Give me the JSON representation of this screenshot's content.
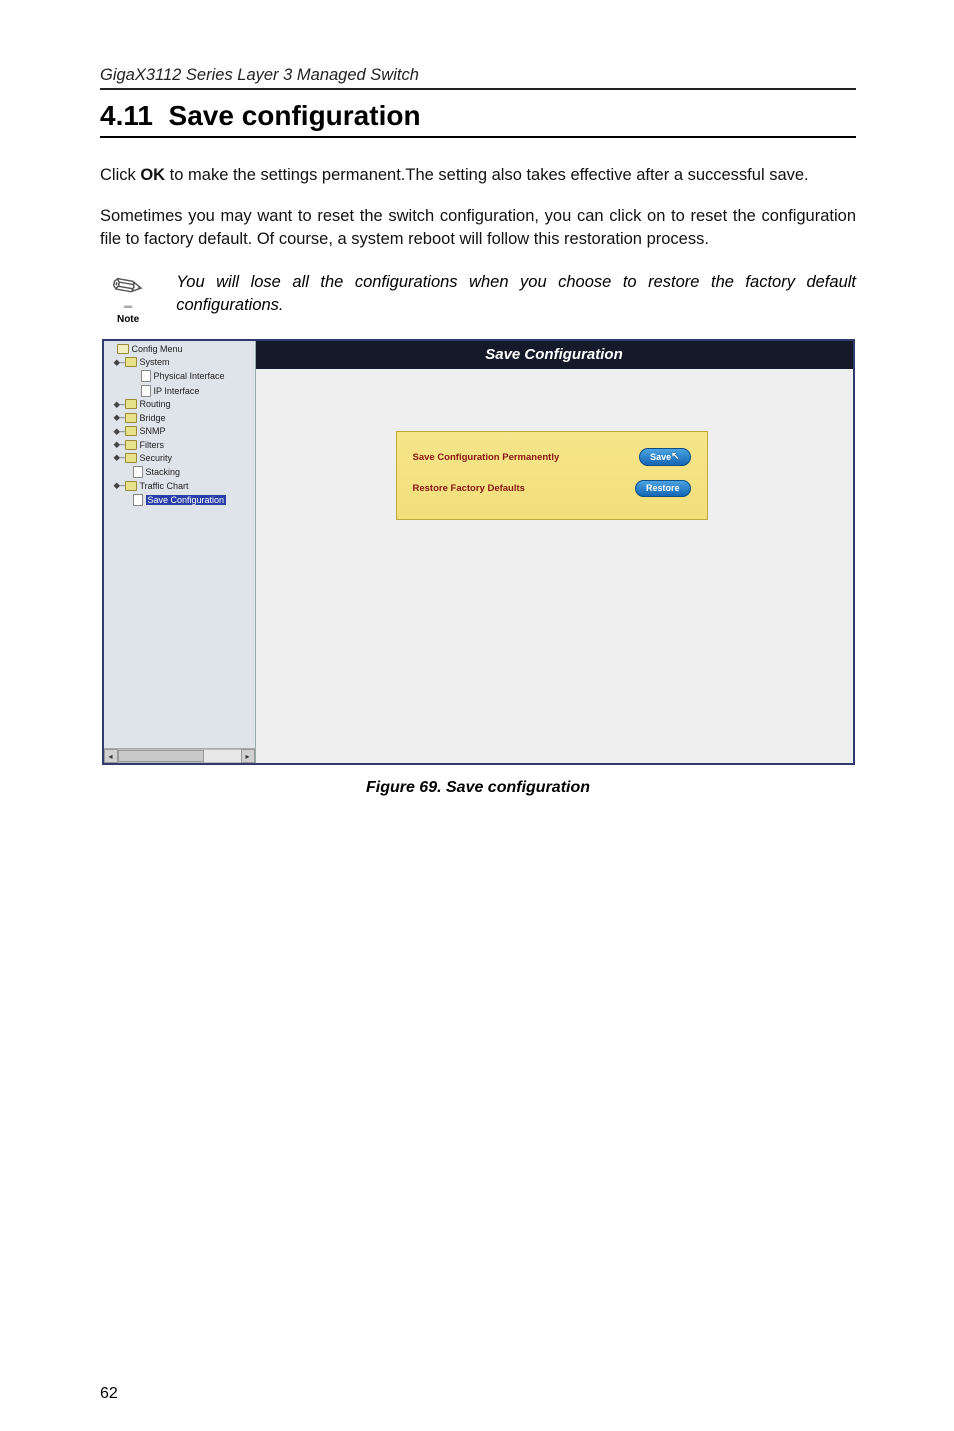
{
  "doc": {
    "header": "GigaX3112 Series Layer 3 Managed Switch",
    "section_number": "4.11",
    "section_title": "Save configuration",
    "para1_pre": "Click ",
    "para1_bold": "OK",
    "para1_post": " to make the settings permanent.The setting also takes effective after a successful save.",
    "para2": "Sometimes you may want to reset the switch configuration, you can click on   to reset the configuration file to factory default. Of course, a system reboot will follow this restoration process.",
    "note_label": "Note",
    "note_text": "You will lose all the configurations when you choose to restore the factory default configurations.",
    "figure_caption": "Figure 69. Save configuration",
    "page_number": "62"
  },
  "ui": {
    "banner": "Save Configuration",
    "sidebar": {
      "root": "Config Menu",
      "items": [
        {
          "label": "System",
          "type": "folder",
          "expanded": true,
          "children": [
            {
              "label": "Physical Interface",
              "type": "page"
            },
            {
              "label": "IP Interface",
              "type": "page"
            }
          ]
        },
        {
          "label": "Routing",
          "type": "folder"
        },
        {
          "label": "Bridge",
          "type": "folder"
        },
        {
          "label": "SNMP",
          "type": "folder"
        },
        {
          "label": "Filters",
          "type": "folder"
        },
        {
          "label": "Security",
          "type": "folder"
        },
        {
          "label": "Stacking",
          "type": "page"
        },
        {
          "label": "Traffic Chart",
          "type": "folder"
        },
        {
          "label": "Save Configuration",
          "type": "page",
          "selected": true
        }
      ]
    },
    "panel": {
      "row1_label": "Save Configuration Permanently",
      "row1_btn": "Save",
      "row2_label": "Restore Factory Defaults",
      "row2_btn": "Restore"
    }
  }
}
